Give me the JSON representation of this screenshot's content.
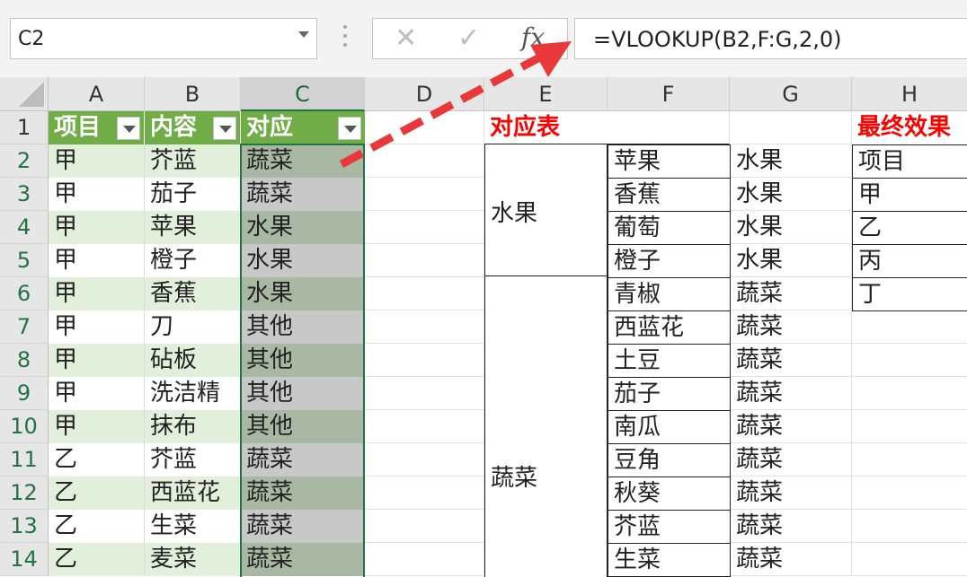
{
  "namebox": {
    "value": "C2"
  },
  "formula": {
    "value": "=VLOOKUP(B2,F:G,2,0)",
    "fx_label": "fx"
  },
  "columns": [
    "A",
    "B",
    "C",
    "D",
    "E",
    "F",
    "G",
    "H"
  ],
  "rows": [
    "1",
    "2",
    "3",
    "4",
    "5",
    "6",
    "7",
    "8",
    "9",
    "10",
    "11",
    "12",
    "13",
    "14"
  ],
  "table": {
    "headers": [
      "项目",
      "内容",
      "对应"
    ],
    "rows": [
      [
        "甲",
        "芥蓝",
        "蔬菜"
      ],
      [
        "甲",
        "茄子",
        "蔬菜"
      ],
      [
        "甲",
        "苹果",
        "水果"
      ],
      [
        "甲",
        "橙子",
        "水果"
      ],
      [
        "甲",
        "香蕉",
        "水果"
      ],
      [
        "甲",
        "刀",
        "其他"
      ],
      [
        "甲",
        "砧板",
        "其他"
      ],
      [
        "甲",
        "洗洁精",
        "其他"
      ],
      [
        "甲",
        "抹布",
        "其他"
      ],
      [
        "乙",
        "芥蓝",
        "蔬菜"
      ],
      [
        "乙",
        "西蓝花",
        "蔬菜"
      ],
      [
        "乙",
        "生菜",
        "蔬菜"
      ],
      [
        "乙",
        "麦菜",
        "蔬菜"
      ]
    ]
  },
  "lookup": {
    "title": "对应表",
    "group_fruit": "水果",
    "group_veg": "蔬菜",
    "rows": [
      [
        "苹果",
        "水果"
      ],
      [
        "香蕉",
        "水果"
      ],
      [
        "葡萄",
        "水果"
      ],
      [
        "橙子",
        "水果"
      ],
      [
        "青椒",
        "蔬菜"
      ],
      [
        "西蓝花",
        "蔬菜"
      ],
      [
        "土豆",
        "蔬菜"
      ],
      [
        "茄子",
        "蔬菜"
      ],
      [
        "南瓜",
        "蔬菜"
      ],
      [
        "豆角",
        "蔬菜"
      ],
      [
        "秋葵",
        "蔬菜"
      ],
      [
        "芥蓝",
        "蔬菜"
      ],
      [
        "生菜",
        "蔬菜"
      ]
    ]
  },
  "result": {
    "title": "最终效果",
    "items": [
      "项目",
      "甲",
      "乙",
      "丙",
      "丁"
    ]
  },
  "colors": {
    "accent": "#217346",
    "header_green": "#70ad47",
    "arrow_red": "#e8383a"
  }
}
